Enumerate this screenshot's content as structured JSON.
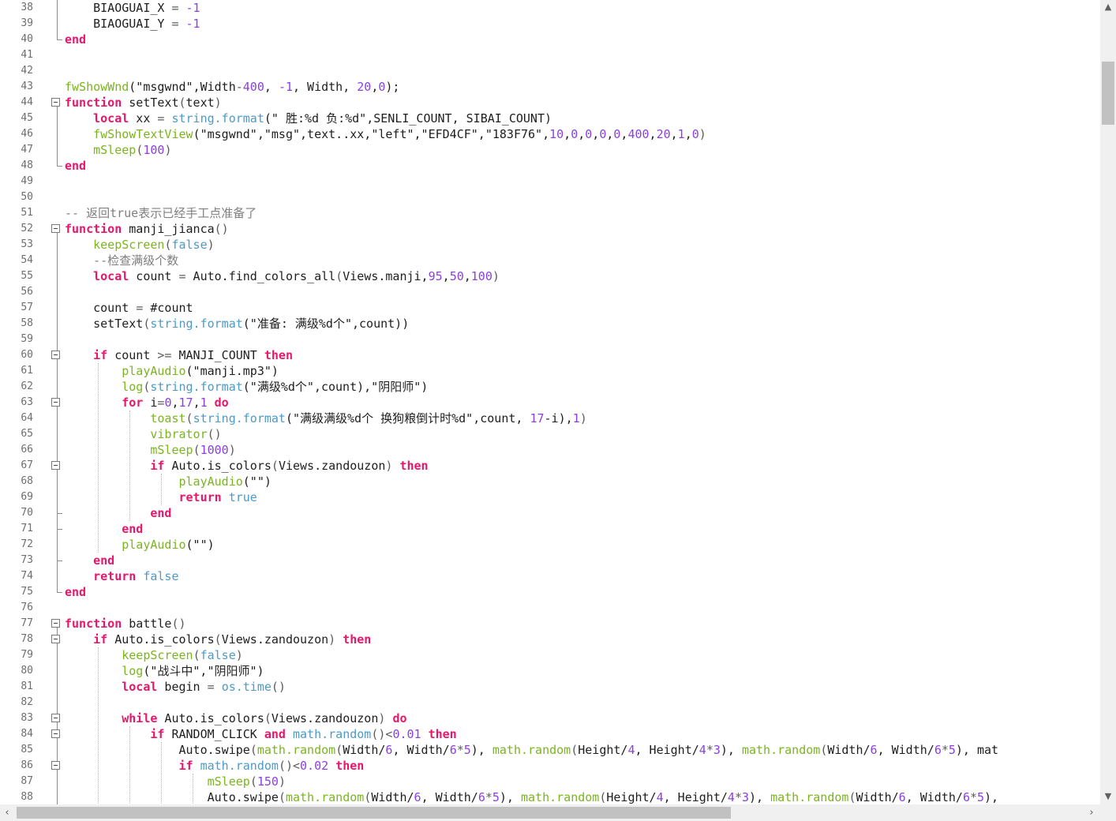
{
  "editor": {
    "first_line": 38,
    "lines": [
      [
        [
          "    BIAOGUAI_X ",
          "p"
        ],
        [
          "=",
          "o"
        ],
        [
          " ",
          "p"
        ],
        [
          "-1",
          "n"
        ]
      ],
      [
        [
          "    BIAOGUAI_Y ",
          "p"
        ],
        [
          "=",
          "o"
        ],
        [
          " ",
          "p"
        ],
        [
          "-1",
          "n"
        ]
      ],
      [
        [
          "end",
          "k"
        ]
      ],
      [],
      [],
      [
        [
          "fwShowWnd",
          "f"
        ],
        [
          "(\"msgwnd\",Width",
          "p"
        ],
        [
          "-",
          "o"
        ],
        [
          "400",
          "n"
        ],
        [
          ", ",
          "p"
        ],
        [
          "-1",
          "n"
        ],
        [
          ", Width, ",
          "p"
        ],
        [
          "20",
          "n"
        ],
        [
          ",",
          "p"
        ],
        [
          "0",
          "n"
        ],
        [
          ");",
          "p"
        ]
      ],
      [
        [
          "function",
          "k"
        ],
        [
          " setText",
          "p"
        ],
        [
          "(",
          "o"
        ],
        [
          "text",
          "p"
        ],
        [
          ")",
          "o"
        ]
      ],
      [
        [
          "    ",
          "p"
        ],
        [
          "local",
          "k"
        ],
        [
          " xx ",
          "p"
        ],
        [
          "=",
          "o"
        ],
        [
          " ",
          "p"
        ],
        [
          "string.format",
          "s"
        ],
        [
          "(\" 胜:%d 负:%d\",SENLI_COUNT, SIBAI_COUNT)",
          "p"
        ]
      ],
      [
        [
          "    ",
          "p"
        ],
        [
          "fwShowTextView",
          "f"
        ],
        [
          "(\"msgwnd\",\"msg\",text..xx,\"left\",\"EFD4CF\",\"183F76\",",
          "p"
        ],
        [
          "10",
          "n"
        ],
        [
          ",",
          "p"
        ],
        [
          "0",
          "n"
        ],
        [
          ",",
          "p"
        ],
        [
          "0",
          "n"
        ],
        [
          ",",
          "p"
        ],
        [
          "0",
          "n"
        ],
        [
          ",",
          "p"
        ],
        [
          "0",
          "n"
        ],
        [
          ",",
          "p"
        ],
        [
          "400",
          "n"
        ],
        [
          ",",
          "p"
        ],
        [
          "20",
          "n"
        ],
        [
          ",",
          "p"
        ],
        [
          "1",
          "n"
        ],
        [
          ",",
          "p"
        ],
        [
          "0",
          "n"
        ],
        [
          ")",
          "o"
        ]
      ],
      [
        [
          "    ",
          "p"
        ],
        [
          "mSleep",
          "f"
        ],
        [
          "(",
          "o"
        ],
        [
          "100",
          "n"
        ],
        [
          ")",
          "o"
        ]
      ],
      [
        [
          "end",
          "k"
        ]
      ],
      [],
      [],
      [
        [
          "-- 返回true表示已经手工点准备了",
          "c"
        ]
      ],
      [
        [
          "function",
          "k"
        ],
        [
          " manji_jianca",
          "p"
        ],
        [
          "()",
          "o"
        ]
      ],
      [
        [
          "    ",
          "p"
        ],
        [
          "keepScreen",
          "f"
        ],
        [
          "(",
          "o"
        ],
        [
          "false",
          "b"
        ],
        [
          ")",
          "o"
        ]
      ],
      [
        [
          "    ",
          "p"
        ],
        [
          "--检查满级个数",
          "c"
        ]
      ],
      [
        [
          "    ",
          "p"
        ],
        [
          "local",
          "k"
        ],
        [
          " count ",
          "p"
        ],
        [
          "=",
          "o"
        ],
        [
          " Auto.find_colors_all",
          "p"
        ],
        [
          "(",
          "o"
        ],
        [
          "Views.manji,",
          "p"
        ],
        [
          "95",
          "n"
        ],
        [
          ",",
          "p"
        ],
        [
          "50",
          "n"
        ],
        [
          ",",
          "p"
        ],
        [
          "100",
          "n"
        ],
        [
          ")",
          "o"
        ]
      ],
      [],
      [
        [
          "    count ",
          "p"
        ],
        [
          "=",
          "o"
        ],
        [
          " #count",
          "p"
        ]
      ],
      [
        [
          "    setText",
          "p"
        ],
        [
          "(",
          "o"
        ],
        [
          "string.format",
          "s"
        ],
        [
          "(\"准备: 满级%d个\",count))",
          "p"
        ]
      ],
      [],
      [
        [
          "    ",
          "p"
        ],
        [
          "if",
          "k"
        ],
        [
          " count ",
          "p"
        ],
        [
          ">=",
          "o"
        ],
        [
          " MANJI_COUNT ",
          "p"
        ],
        [
          "then",
          "k"
        ]
      ],
      [
        [
          "        ",
          "p"
        ],
        [
          "playAudio",
          "f"
        ],
        [
          "(\"manji.mp3\")",
          "p"
        ]
      ],
      [
        [
          "        ",
          "p"
        ],
        [
          "log",
          "f"
        ],
        [
          "(",
          "o"
        ],
        [
          "string.format",
          "s"
        ],
        [
          "(\"满级%d个\",count),\"阴阳师\")",
          "p"
        ]
      ],
      [
        [
          "        ",
          "p"
        ],
        [
          "for",
          "k"
        ],
        [
          " i",
          "p"
        ],
        [
          "=",
          "o"
        ],
        [
          "0",
          "n"
        ],
        [
          ",",
          "p"
        ],
        [
          "17",
          "n"
        ],
        [
          ",",
          "p"
        ],
        [
          "1",
          "n"
        ],
        [
          " ",
          "p"
        ],
        [
          "do",
          "k"
        ]
      ],
      [
        [
          "            ",
          "p"
        ],
        [
          "toast",
          "f"
        ],
        [
          "(",
          "o"
        ],
        [
          "string.format",
          "s"
        ],
        [
          "(\"满级满级%d个 换狗粮倒计时%d\",count, ",
          "p"
        ],
        [
          "17",
          "n"
        ],
        [
          "-i),",
          "p"
        ],
        [
          "1",
          "n"
        ],
        [
          ")",
          "o"
        ]
      ],
      [
        [
          "            ",
          "p"
        ],
        [
          "vibrator",
          "f"
        ],
        [
          "()",
          "o"
        ]
      ],
      [
        [
          "            ",
          "p"
        ],
        [
          "mSleep",
          "f"
        ],
        [
          "(",
          "o"
        ],
        [
          "1000",
          "n"
        ],
        [
          ")",
          "o"
        ]
      ],
      [
        [
          "            ",
          "p"
        ],
        [
          "if",
          "k"
        ],
        [
          " Auto.is_colors",
          "p"
        ],
        [
          "(",
          "o"
        ],
        [
          "Views.zandouzon",
          "p"
        ],
        [
          ")",
          "o"
        ],
        [
          " ",
          "p"
        ],
        [
          "then",
          "k"
        ]
      ],
      [
        [
          "                ",
          "p"
        ],
        [
          "playAudio",
          "f"
        ],
        [
          "(\"\")",
          "p"
        ]
      ],
      [
        [
          "                ",
          "p"
        ],
        [
          "return",
          "k"
        ],
        [
          " ",
          "p"
        ],
        [
          "true",
          "b"
        ]
      ],
      [
        [
          "            ",
          "p"
        ],
        [
          "end",
          "k"
        ]
      ],
      [
        [
          "        ",
          "p"
        ],
        [
          "end",
          "k"
        ]
      ],
      [
        [
          "        ",
          "p"
        ],
        [
          "playAudio",
          "f"
        ],
        [
          "(\"\")",
          "p"
        ]
      ],
      [
        [
          "    ",
          "p"
        ],
        [
          "end",
          "k"
        ]
      ],
      [
        [
          "    ",
          "p"
        ],
        [
          "return",
          "k"
        ],
        [
          " ",
          "p"
        ],
        [
          "false",
          "b"
        ]
      ],
      [
        [
          "end",
          "k"
        ]
      ],
      [],
      [
        [
          "function",
          "k"
        ],
        [
          " battle",
          "p"
        ],
        [
          "()",
          "o"
        ]
      ],
      [
        [
          "    ",
          "p"
        ],
        [
          "if",
          "k"
        ],
        [
          " Auto.is_colors",
          "p"
        ],
        [
          "(",
          "o"
        ],
        [
          "Views.zandouzon",
          "p"
        ],
        [
          ")",
          "o"
        ],
        [
          " ",
          "p"
        ],
        [
          "then",
          "k"
        ]
      ],
      [
        [
          "        ",
          "p"
        ],
        [
          "keepScreen",
          "f"
        ],
        [
          "(",
          "o"
        ],
        [
          "false",
          "b"
        ],
        [
          ")",
          "o"
        ]
      ],
      [
        [
          "        ",
          "p"
        ],
        [
          "log",
          "f"
        ],
        [
          "(\"战斗中\",\"阴阳师\")",
          "p"
        ]
      ],
      [
        [
          "        ",
          "p"
        ],
        [
          "local",
          "k"
        ],
        [
          " begin ",
          "p"
        ],
        [
          "=",
          "o"
        ],
        [
          " ",
          "p"
        ],
        [
          "os.time",
          "s"
        ],
        [
          "()",
          "o"
        ]
      ],
      [],
      [
        [
          "        ",
          "p"
        ],
        [
          "while",
          "k"
        ],
        [
          " Auto.is_colors",
          "p"
        ],
        [
          "(",
          "o"
        ],
        [
          "Views.zandouzon",
          "p"
        ],
        [
          ")",
          "o"
        ],
        [
          " ",
          "p"
        ],
        [
          "do",
          "k"
        ]
      ],
      [
        [
          "            ",
          "p"
        ],
        [
          "if",
          "k"
        ],
        [
          " RANDOM_CLICK ",
          "p"
        ],
        [
          "and",
          "k"
        ],
        [
          " ",
          "p"
        ],
        [
          "math.random",
          "s"
        ],
        [
          "()",
          "o"
        ],
        [
          "<",
          "o"
        ],
        [
          "0.01",
          "n"
        ],
        [
          " ",
          "p"
        ],
        [
          "then",
          "k"
        ]
      ],
      [
        [
          "                Auto.swipe",
          "p"
        ],
        [
          "(",
          "o"
        ],
        [
          "math.random",
          "f"
        ],
        [
          "(",
          "o"
        ],
        [
          "Width/",
          "p"
        ],
        [
          "6",
          "n"
        ],
        [
          ", Width/",
          "p"
        ],
        [
          "6",
          "n"
        ],
        [
          "*",
          "o"
        ],
        [
          "5",
          "n"
        ],
        [
          "), ",
          "p"
        ],
        [
          "math.random",
          "f"
        ],
        [
          "(",
          "o"
        ],
        [
          "Height/",
          "p"
        ],
        [
          "4",
          "n"
        ],
        [
          ", Height/",
          "p"
        ],
        [
          "4",
          "n"
        ],
        [
          "*",
          "o"
        ],
        [
          "3",
          "n"
        ],
        [
          "), ",
          "p"
        ],
        [
          "math.random",
          "f"
        ],
        [
          "(",
          "o"
        ],
        [
          "Width/",
          "p"
        ],
        [
          "6",
          "n"
        ],
        [
          ", Width/",
          "p"
        ],
        [
          "6",
          "n"
        ],
        [
          "*",
          "o"
        ],
        [
          "5",
          "n"
        ],
        [
          "), mat",
          "p"
        ]
      ],
      [
        [
          "                ",
          "p"
        ],
        [
          "if",
          "k"
        ],
        [
          " ",
          "p"
        ],
        [
          "math.random",
          "s"
        ],
        [
          "()",
          "o"
        ],
        [
          "<",
          "o"
        ],
        [
          "0.02",
          "n"
        ],
        [
          " ",
          "p"
        ],
        [
          "then",
          "k"
        ]
      ],
      [
        [
          "                    ",
          "p"
        ],
        [
          "mSleep",
          "f"
        ],
        [
          "(",
          "o"
        ],
        [
          "150",
          "n"
        ],
        [
          ")",
          "o"
        ]
      ],
      [
        [
          "                    Auto.swipe",
          "p"
        ],
        [
          "(",
          "o"
        ],
        [
          "math.random",
          "f"
        ],
        [
          "(",
          "o"
        ],
        [
          "Width/",
          "p"
        ],
        [
          "6",
          "n"
        ],
        [
          ", Width/",
          "p"
        ],
        [
          "6",
          "n"
        ],
        [
          "*",
          "o"
        ],
        [
          "5",
          "n"
        ],
        [
          "), ",
          "p"
        ],
        [
          "math.random",
          "f"
        ],
        [
          "(",
          "o"
        ],
        [
          "Height/",
          "p"
        ],
        [
          "4",
          "n"
        ],
        [
          ", Height/",
          "p"
        ],
        [
          "4",
          "n"
        ],
        [
          "*",
          "o"
        ],
        [
          "3",
          "n"
        ],
        [
          "), ",
          "p"
        ],
        [
          "math.random",
          "f"
        ],
        [
          "(",
          "o"
        ],
        [
          "Width/",
          "p"
        ],
        [
          "6",
          "n"
        ],
        [
          ", Width/",
          "p"
        ],
        [
          "6",
          "n"
        ],
        [
          "*",
          "o"
        ],
        [
          "5",
          "n"
        ],
        [
          "),",
          "p"
        ]
      ]
    ],
    "colors": {
      "keyword": "#e8166a",
      "function": "#7ab51d",
      "stdlib": "#4d9ac8",
      "number": "#8a3fe6",
      "comment": "#7f7f7f"
    }
  },
  "scrollbars": {
    "up_icon": "▲",
    "down_icon": "▼",
    "left_icon": "‹",
    "right_icon": "›"
  }
}
